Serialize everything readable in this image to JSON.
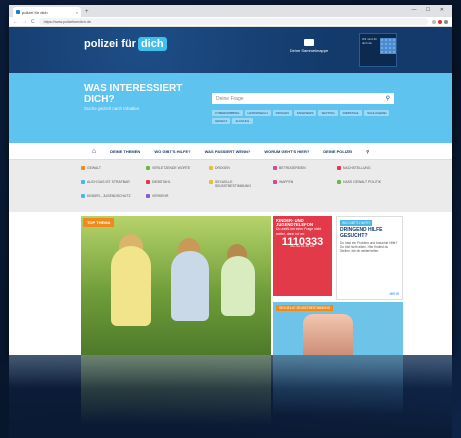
{
  "browser": {
    "tab_title": "polizei für dich",
    "url": "https://www.polizeifuerdich.de",
    "new_tab": "+",
    "tab_close": "×",
    "nav_back": "←",
    "nav_forward": "→",
    "nav_reload": "C",
    "window_controls": "— ☐ ✕"
  },
  "header": {
    "logo_text": "polizei für",
    "logo_highlight": "dich",
    "sammelmappe": "Deine Sammelmappe",
    "badge_text": "Wir sind für dich da"
  },
  "hero": {
    "title": "WAS INTERESSIERT DICH?",
    "subtitle": "Suche gezielt nach Inhalten",
    "search_placeholder": "Deine Frage",
    "tags": [
      "CYBERMOBBING",
      "HATESPEECH",
      "DROGEN",
      "FAKENEWS",
      "SEXTING",
      "DIEBSTAHL",
      "SCHLÄGEREI",
      "GEWALT",
      "ALKOHOL"
    ]
  },
  "nav": {
    "home_icon": "⌂",
    "items": [
      "DEINE THEMEN",
      "WO GIBT'S HILFE?",
      "WAS PASSIERT WENN?",
      "WORUM GEHT'S HIER?",
      "DEINE POLIZEI"
    ],
    "search_icon": "⚲"
  },
  "categories": [
    {
      "label": "GEWALT",
      "color": "#f08a1c"
    },
    {
      "label": "VERLETZENDE WORTE",
      "color": "#6bb84a"
    },
    {
      "label": "DROGEN",
      "color": "#e0c13a"
    },
    {
      "label": "BETRÜGEREIEN",
      "color": "#d6488f"
    },
    {
      "label": "NACHSTELLUNG",
      "color": "#e23a48"
    },
    {
      "label": "AUCH DAS IST STRAFBAR",
      "color": "#4bb5e6"
    },
    {
      "label": "DIEBSTAHL",
      "color": "#e23a48"
    },
    {
      "label": "SEXUELLE SELBSTBESTIMMUNG",
      "color": "#e0c13a"
    },
    {
      "label": "WAFFEN",
      "color": "#d6488f"
    },
    {
      "label": "HASS GEWALT POLITIK",
      "color": "#6bb84a"
    },
    {
      "label": "KINDER-, JUGENDSCHUTZ",
      "color": "#4bb5e6"
    },
    {
      "label": "VERKEHR",
      "color": "#8a5cc7"
    }
  ],
  "featured": {
    "tag": "TOP THEMA"
  },
  "hotline": {
    "title": "KINDER- UND JUGENDTELEFON",
    "text": "Du weißt bei einer Frage nicht weiter, dann ruf an:",
    "number": "1110333",
    "note": "Mo–Sa 14–20 Uhr"
  },
  "help": {
    "label": "WO GIBT'S HILFE?",
    "title": "DRINGEND HILFE GESUCHT?",
    "text": "Du hast ein Problem und brauchst Hilfe? Du bist nicht allein. Hier findest du Stellen, die dir weiterhelfen.",
    "more": "MEHR"
  },
  "bottom_card": {
    "label": "SEXUELLE SELBSTBESTIMMUNG"
  }
}
